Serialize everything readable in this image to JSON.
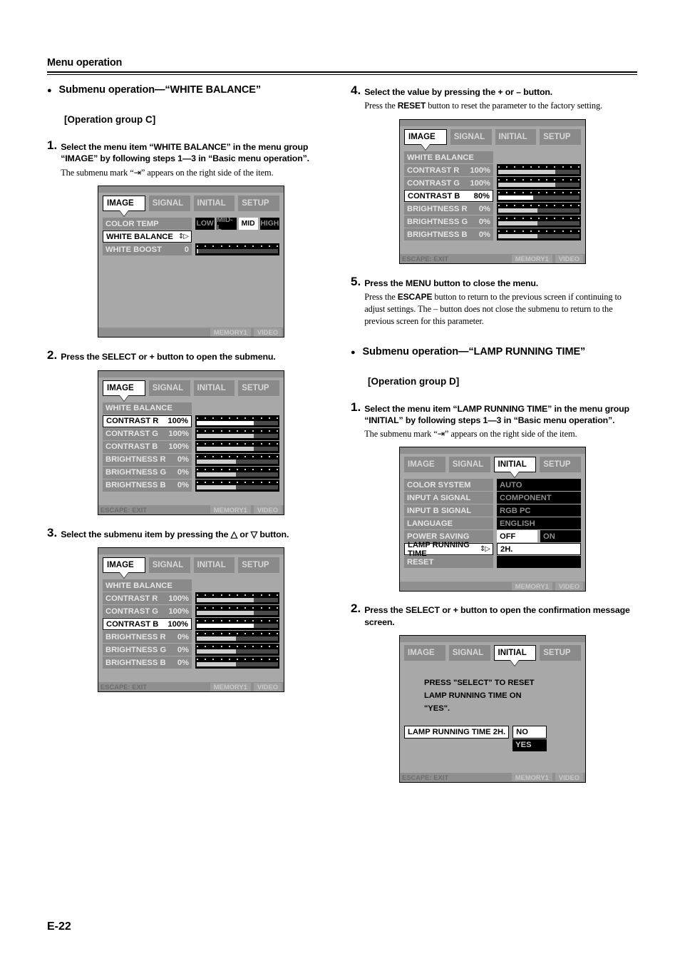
{
  "header": {
    "title": "Menu operation"
  },
  "page_number": "E-22",
  "left_column": {
    "bullet_heading": "Submenu operation—“WHITE BALANCE”",
    "group_heading": "[Operation group C]",
    "steps": [
      {
        "num": "1.",
        "title": "Select the menu item “WHITE BALANCE” in the menu group “IMAGE” by following steps 1—3 in “Basic menu operation”.",
        "note": "The submenu mark “⇥” appears on the right side of the item."
      },
      {
        "num": "2.",
        "title": "Press the SELECT or + button to open the submenu."
      },
      {
        "num": "3.",
        "title": "Select the submenu item by pressing the △ or ▽ button."
      }
    ]
  },
  "right_column": {
    "steps": [
      {
        "num": "4.",
        "title": "Select the value by pressing the + or – button.",
        "note_pre": "Press the ",
        "note_bold": "RESET",
        "note_post": " button to reset the parameter to the factory setting."
      },
      {
        "num": "5.",
        "title": "Press the MENU button to close the menu.",
        "note_pre": "Press the ",
        "note_bold": "ESCAPE",
        "note_post": " button to return to the previous screen if continuing to adjust settings. The – button does not close the submenu to return to the previous screen for this parameter."
      }
    ],
    "bullet_heading": "Submenu operation—“LAMP RUNNING TIME”",
    "group_heading": "[Operation group D]",
    "steps_d": [
      {
        "num": "1.",
        "title": "Select the menu item “LAMP RUNNING TIME” in the menu group “INITIAL” by following steps 1—3 in “Basic menu operation”.",
        "note": "The submenu mark “⇥” appears on the right side of the item."
      },
      {
        "num": "2.",
        "title": "Press the SELECT or + button to open the confirmation message screen."
      }
    ]
  },
  "osd_common": {
    "tabs": [
      "IMAGE",
      "SIGNAL",
      "INITIAL",
      "SETUP"
    ],
    "bottom": {
      "escape": "ESCAPE: EXIT",
      "memory": "MEMORY1",
      "input": "VIDEO"
    },
    "submenu_mark": "⇕▷"
  },
  "screens": {
    "image_colortemp": {
      "active_tab": "IMAGE",
      "rows": [
        {
          "label": "COLOR TEMP",
          "value": "",
          "type": "segments",
          "options": [
            "LOW",
            "MID-L",
            "MID",
            "HIGH"
          ],
          "selected": "MID",
          "highlight": false
        },
        {
          "label": "WHITE BALANCE",
          "value": "",
          "type": "submenu",
          "highlight": true
        },
        {
          "label": "WHITE BOOST",
          "value": "0",
          "type": "slider",
          "fill_pct": 2,
          "highlight": false
        }
      ],
      "bottom_escape_visible": false
    },
    "white_balance_r": {
      "active_tab": "IMAGE",
      "title_row": "WHITE BALANCE",
      "rows": [
        {
          "label": "CONTRAST R",
          "value": "100%",
          "fill_pct": 70,
          "highlight": true
        },
        {
          "label": "CONTRAST G",
          "value": "100%",
          "fill_pct": 70,
          "highlight": false
        },
        {
          "label": "CONTRAST B",
          "value": "100%",
          "fill_pct": 70,
          "highlight": false
        },
        {
          "label": "BRIGHTNESS R",
          "value": "0%",
          "fill_pct": 48,
          "highlight": false
        },
        {
          "label": "BRIGHTNESS G",
          "value": "0%",
          "fill_pct": 48,
          "highlight": false
        },
        {
          "label": "BRIGHTNESS B",
          "value": "0%",
          "fill_pct": 48,
          "highlight": false
        }
      ]
    },
    "white_balance_b": {
      "active_tab": "IMAGE",
      "title_row": "WHITE BALANCE",
      "rows": [
        {
          "label": "CONTRAST R",
          "value": "100%",
          "fill_pct": 70,
          "highlight": false
        },
        {
          "label": "CONTRAST G",
          "value": "100%",
          "fill_pct": 70,
          "highlight": false
        },
        {
          "label": "CONTRAST B",
          "value": "100%",
          "fill_pct": 70,
          "highlight": true
        },
        {
          "label": "BRIGHTNESS R",
          "value": "0%",
          "fill_pct": 48,
          "highlight": false
        },
        {
          "label": "BRIGHTNESS G",
          "value": "0%",
          "fill_pct": 48,
          "highlight": false
        },
        {
          "label": "BRIGHTNESS B",
          "value": "0%",
          "fill_pct": 48,
          "highlight": false
        }
      ]
    },
    "white_balance_b80": {
      "active_tab": "IMAGE",
      "title_row": "WHITE BALANCE",
      "rows": [
        {
          "label": "CONTRAST R",
          "value": "100%",
          "fill_pct": 70,
          "highlight": false
        },
        {
          "label": "CONTRAST G",
          "value": "100%",
          "fill_pct": 70,
          "highlight": false
        },
        {
          "label": "CONTRAST B",
          "value": "80%",
          "fill_pct": 43,
          "highlight": true
        },
        {
          "label": "BRIGHTNESS R",
          "value": "0%",
          "fill_pct": 48,
          "highlight": false
        },
        {
          "label": "BRIGHTNESS G",
          "value": "0%",
          "fill_pct": 48,
          "highlight": false
        },
        {
          "label": "BRIGHTNESS B",
          "value": "0%",
          "fill_pct": 48,
          "highlight": false
        }
      ]
    },
    "initial_menu": {
      "active_tab": "INITIAL",
      "rows": [
        {
          "label": "COLOR SYSTEM",
          "value": "AUTO",
          "type": "field",
          "highlight": false
        },
        {
          "label": "INPUT A SIGNAL",
          "value": "COMPONENT",
          "type": "field",
          "highlight": false
        },
        {
          "label": "INPUT B SIGNAL",
          "value": "RGB PC",
          "type": "field",
          "highlight": false
        },
        {
          "label": "LANGUAGE",
          "value": "ENGLISH",
          "type": "field",
          "highlight": false
        },
        {
          "label": "POWER SAVING",
          "value": "",
          "type": "two",
          "options": [
            "OFF",
            "ON"
          ],
          "selected": "OFF",
          "highlight": false
        },
        {
          "label": "LAMP RUNNING TIME",
          "value": "2H.",
          "type": "submenu_field",
          "highlight": true
        },
        {
          "label": "RESET",
          "value": "",
          "type": "field_empty",
          "highlight": false
        }
      ],
      "bottom_escape_visible": false
    },
    "confirm_screen": {
      "active_tab": "INITIAL",
      "message_lines": [
        "PRESS \"SELECT\" TO RESET",
        "LAMP RUNNING TIME ON",
        "\"YES\"."
      ],
      "confirm_label": "LAMP RUNNING TIME 2H.",
      "option_no": "NO",
      "option_yes": "YES"
    }
  }
}
